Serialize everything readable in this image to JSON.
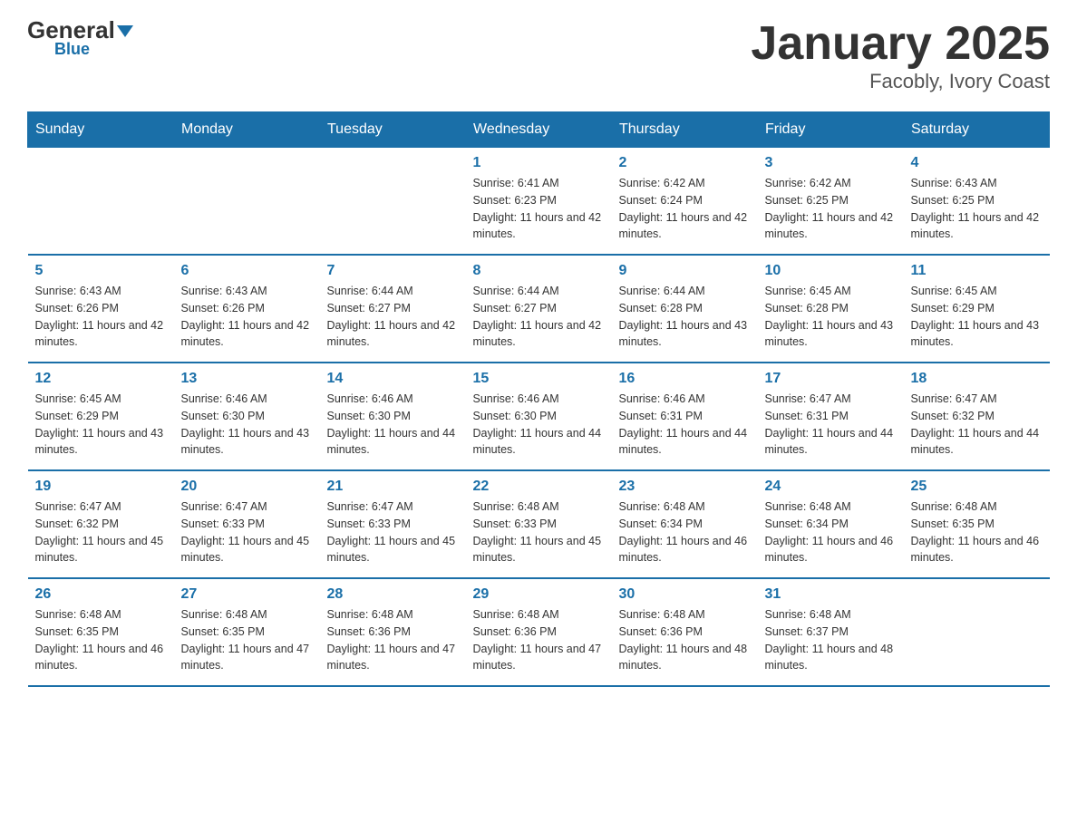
{
  "logo": {
    "general": "General",
    "blue": "Blue"
  },
  "title": {
    "month_year": "January 2025",
    "location": "Facobly, Ivory Coast"
  },
  "headers": [
    "Sunday",
    "Monday",
    "Tuesday",
    "Wednesday",
    "Thursday",
    "Friday",
    "Saturday"
  ],
  "weeks": [
    [
      {
        "day": "",
        "info": ""
      },
      {
        "day": "",
        "info": ""
      },
      {
        "day": "",
        "info": ""
      },
      {
        "day": "1",
        "info": "Sunrise: 6:41 AM\nSunset: 6:23 PM\nDaylight: 11 hours and 42 minutes."
      },
      {
        "day": "2",
        "info": "Sunrise: 6:42 AM\nSunset: 6:24 PM\nDaylight: 11 hours and 42 minutes."
      },
      {
        "day": "3",
        "info": "Sunrise: 6:42 AM\nSunset: 6:25 PM\nDaylight: 11 hours and 42 minutes."
      },
      {
        "day": "4",
        "info": "Sunrise: 6:43 AM\nSunset: 6:25 PM\nDaylight: 11 hours and 42 minutes."
      }
    ],
    [
      {
        "day": "5",
        "info": "Sunrise: 6:43 AM\nSunset: 6:26 PM\nDaylight: 11 hours and 42 minutes."
      },
      {
        "day": "6",
        "info": "Sunrise: 6:43 AM\nSunset: 6:26 PM\nDaylight: 11 hours and 42 minutes."
      },
      {
        "day": "7",
        "info": "Sunrise: 6:44 AM\nSunset: 6:27 PM\nDaylight: 11 hours and 42 minutes."
      },
      {
        "day": "8",
        "info": "Sunrise: 6:44 AM\nSunset: 6:27 PM\nDaylight: 11 hours and 42 minutes."
      },
      {
        "day": "9",
        "info": "Sunrise: 6:44 AM\nSunset: 6:28 PM\nDaylight: 11 hours and 43 minutes."
      },
      {
        "day": "10",
        "info": "Sunrise: 6:45 AM\nSunset: 6:28 PM\nDaylight: 11 hours and 43 minutes."
      },
      {
        "day": "11",
        "info": "Sunrise: 6:45 AM\nSunset: 6:29 PM\nDaylight: 11 hours and 43 minutes."
      }
    ],
    [
      {
        "day": "12",
        "info": "Sunrise: 6:45 AM\nSunset: 6:29 PM\nDaylight: 11 hours and 43 minutes."
      },
      {
        "day": "13",
        "info": "Sunrise: 6:46 AM\nSunset: 6:30 PM\nDaylight: 11 hours and 43 minutes."
      },
      {
        "day": "14",
        "info": "Sunrise: 6:46 AM\nSunset: 6:30 PM\nDaylight: 11 hours and 44 minutes."
      },
      {
        "day": "15",
        "info": "Sunrise: 6:46 AM\nSunset: 6:30 PM\nDaylight: 11 hours and 44 minutes."
      },
      {
        "day": "16",
        "info": "Sunrise: 6:46 AM\nSunset: 6:31 PM\nDaylight: 11 hours and 44 minutes."
      },
      {
        "day": "17",
        "info": "Sunrise: 6:47 AM\nSunset: 6:31 PM\nDaylight: 11 hours and 44 minutes."
      },
      {
        "day": "18",
        "info": "Sunrise: 6:47 AM\nSunset: 6:32 PM\nDaylight: 11 hours and 44 minutes."
      }
    ],
    [
      {
        "day": "19",
        "info": "Sunrise: 6:47 AM\nSunset: 6:32 PM\nDaylight: 11 hours and 45 minutes."
      },
      {
        "day": "20",
        "info": "Sunrise: 6:47 AM\nSunset: 6:33 PM\nDaylight: 11 hours and 45 minutes."
      },
      {
        "day": "21",
        "info": "Sunrise: 6:47 AM\nSunset: 6:33 PM\nDaylight: 11 hours and 45 minutes."
      },
      {
        "day": "22",
        "info": "Sunrise: 6:48 AM\nSunset: 6:33 PM\nDaylight: 11 hours and 45 minutes."
      },
      {
        "day": "23",
        "info": "Sunrise: 6:48 AM\nSunset: 6:34 PM\nDaylight: 11 hours and 46 minutes."
      },
      {
        "day": "24",
        "info": "Sunrise: 6:48 AM\nSunset: 6:34 PM\nDaylight: 11 hours and 46 minutes."
      },
      {
        "day": "25",
        "info": "Sunrise: 6:48 AM\nSunset: 6:35 PM\nDaylight: 11 hours and 46 minutes."
      }
    ],
    [
      {
        "day": "26",
        "info": "Sunrise: 6:48 AM\nSunset: 6:35 PM\nDaylight: 11 hours and 46 minutes."
      },
      {
        "day": "27",
        "info": "Sunrise: 6:48 AM\nSunset: 6:35 PM\nDaylight: 11 hours and 47 minutes."
      },
      {
        "day": "28",
        "info": "Sunrise: 6:48 AM\nSunset: 6:36 PM\nDaylight: 11 hours and 47 minutes."
      },
      {
        "day": "29",
        "info": "Sunrise: 6:48 AM\nSunset: 6:36 PM\nDaylight: 11 hours and 47 minutes."
      },
      {
        "day": "30",
        "info": "Sunrise: 6:48 AM\nSunset: 6:36 PM\nDaylight: 11 hours and 48 minutes."
      },
      {
        "day": "31",
        "info": "Sunrise: 6:48 AM\nSunset: 6:37 PM\nDaylight: 11 hours and 48 minutes."
      },
      {
        "day": "",
        "info": ""
      }
    ]
  ]
}
